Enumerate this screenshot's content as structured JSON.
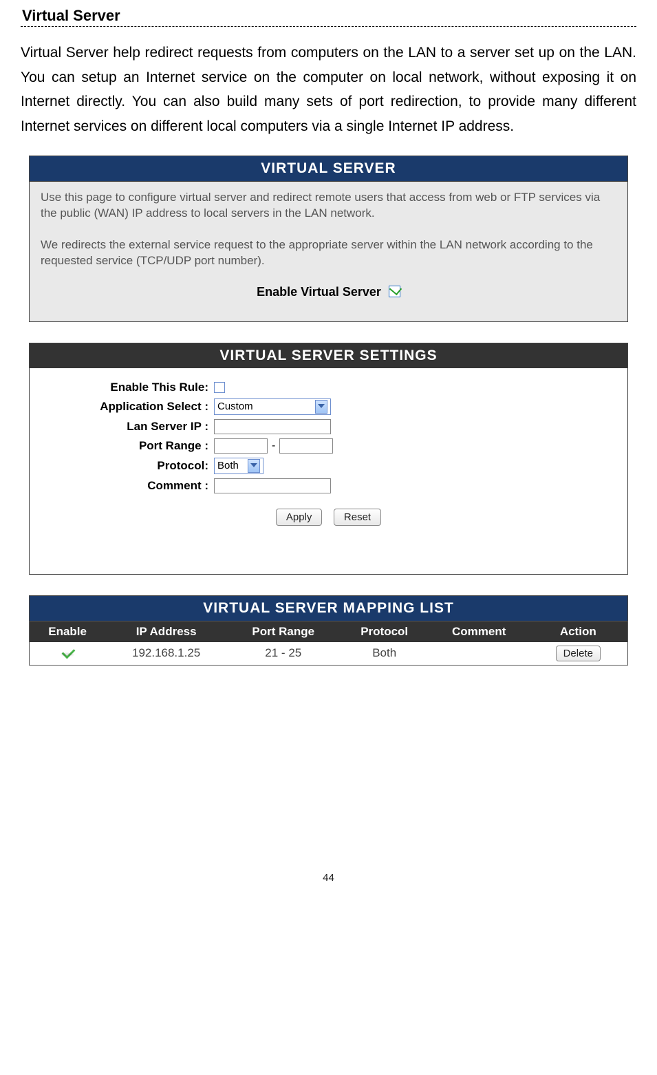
{
  "doc": {
    "title": "Virtual Server",
    "intro": "Virtual Server help redirect requests from computers on the LAN to a server set up on the LAN. You can setup an Internet service on the computer on local network, without exposing it on Internet directly. You can also build many sets of port redirection, to provide many different Internet services on different local computers via a single Internet IP address.",
    "page_number": "44"
  },
  "panel1": {
    "header": "VIRTUAL SERVER",
    "desc1": "Use this page to configure virtual server and redirect remote users that access from web or FTP services via the public (WAN) IP address to local servers in the LAN network.",
    "desc2": "We redirects the external service request to the appropriate server within the LAN network according to the requested service (TCP/UDP port number).",
    "enable_label": "Enable Virtual Server",
    "enable_checked": true
  },
  "panel2": {
    "header": "VIRTUAL SERVER SETTINGS",
    "labels": {
      "enable_rule": "Enable This Rule:",
      "app_select": "Application Select :",
      "lan_ip": "Lan Server IP :",
      "port_range": "Port Range :",
      "protocol": "Protocol:",
      "comment": "Comment :"
    },
    "values": {
      "app_select": "Custom",
      "protocol": "Both",
      "port_sep": "-"
    },
    "buttons": {
      "apply": "Apply",
      "reset": "Reset"
    }
  },
  "panel3": {
    "header": "VIRTUAL SERVER MAPPING LIST",
    "columns": {
      "enable": "Enable",
      "ip": "IP Address",
      "port": "Port Range",
      "protocol": "Protocol",
      "comment": "Comment",
      "action": "Action"
    },
    "row": {
      "ip": "192.168.1.25",
      "port": "21 - 25",
      "protocol": "Both",
      "comment": "",
      "action_btn": "Delete"
    }
  }
}
